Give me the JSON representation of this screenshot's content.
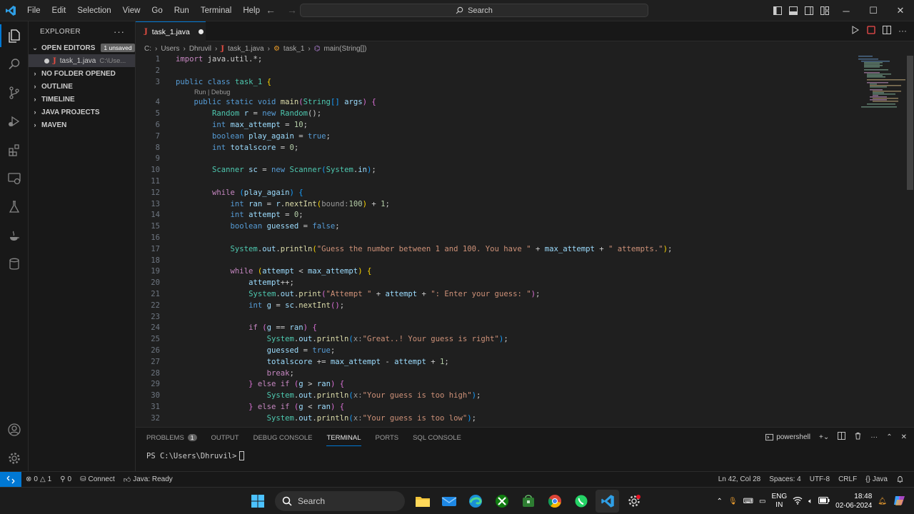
{
  "window": {
    "menu": [
      "File",
      "Edit",
      "Selection",
      "View",
      "Go",
      "Run",
      "Terminal",
      "Help"
    ],
    "search_label": "Search"
  },
  "sidebar": {
    "title": "EXPLORER",
    "open_editors": "OPEN EDITORS",
    "unsaved_badge": "1 unsaved",
    "open_file_name": "task_1.java",
    "open_file_path": "C:\\Use...",
    "sections": [
      "NO FOLDER OPENED",
      "OUTLINE",
      "TIMELINE",
      "JAVA PROJECTS",
      "MAVEN"
    ]
  },
  "editor": {
    "tab_label": "task_1.java",
    "breadcrumb": [
      "C:",
      "Users",
      "Dhruvil",
      "task_1.java",
      "task_1",
      "main(String[])"
    ],
    "codelens": "Run | Debug",
    "lines": [
      {
        "n": "1",
        "tokens": [
          [
            "import",
            "c"
          ],
          [
            " java.util.*;",
            ""
          ]
        ]
      },
      {
        "n": "2",
        "tokens": []
      },
      {
        "n": "3",
        "tokens": [
          [
            "public",
            "k"
          ],
          [
            " ",
            ""
          ],
          [
            "class",
            "k"
          ],
          [
            " ",
            ""
          ],
          [
            "task_1",
            "t"
          ],
          [
            " ",
            ""
          ],
          [
            "{",
            "p"
          ]
        ]
      },
      {
        "n": "4",
        "lens": true,
        "tokens": [
          [
            "    ",
            ""
          ],
          [
            "public",
            "k"
          ],
          [
            " ",
            ""
          ],
          [
            "static",
            "k"
          ],
          [
            " ",
            ""
          ],
          [
            "void",
            "k"
          ],
          [
            " ",
            ""
          ],
          [
            "main",
            "f"
          ],
          [
            "(",
            "pp"
          ],
          [
            "String",
            "t"
          ],
          [
            "[]",
            "pb"
          ],
          [
            " ",
            ""
          ],
          [
            "args",
            "v"
          ],
          [
            ")",
            "pp"
          ],
          [
            " ",
            ""
          ],
          [
            "{",
            "pp"
          ]
        ]
      },
      {
        "n": "5",
        "tokens": [
          [
            "        ",
            ""
          ],
          [
            "Random",
            "t"
          ],
          [
            " ",
            ""
          ],
          [
            "r",
            "v"
          ],
          [
            " = ",
            ""
          ],
          [
            "new",
            "k"
          ],
          [
            " ",
            ""
          ],
          [
            "Random",
            "t"
          ],
          [
            "();",
            ""
          ]
        ]
      },
      {
        "n": "6",
        "tokens": [
          [
            "        ",
            ""
          ],
          [
            "int",
            "k"
          ],
          [
            " ",
            ""
          ],
          [
            "max_attempt",
            "v"
          ],
          [
            " = ",
            ""
          ],
          [
            "10",
            "n"
          ],
          [
            ";",
            ""
          ]
        ]
      },
      {
        "n": "7",
        "tokens": [
          [
            "        ",
            ""
          ],
          [
            "boolean",
            "k"
          ],
          [
            " ",
            ""
          ],
          [
            "play_again",
            "v"
          ],
          [
            " = ",
            ""
          ],
          [
            "true",
            "k"
          ],
          [
            ";",
            ""
          ]
        ]
      },
      {
        "n": "8",
        "tokens": [
          [
            "        ",
            ""
          ],
          [
            "int",
            "k"
          ],
          [
            " ",
            ""
          ],
          [
            "totalscore",
            "v"
          ],
          [
            " = ",
            ""
          ],
          [
            "0",
            "n"
          ],
          [
            ";",
            ""
          ]
        ]
      },
      {
        "n": "9",
        "tokens": []
      },
      {
        "n": "10",
        "tokens": [
          [
            "        ",
            ""
          ],
          [
            "Scanner",
            "t"
          ],
          [
            " ",
            ""
          ],
          [
            "sc",
            "v"
          ],
          [
            " = ",
            ""
          ],
          [
            "new",
            "k"
          ],
          [
            " ",
            ""
          ],
          [
            "Scanner",
            "t"
          ],
          [
            "(",
            "pb"
          ],
          [
            "System",
            "t"
          ],
          [
            ".",
            ""
          ],
          [
            "in",
            "v"
          ],
          [
            ")",
            "pb"
          ],
          [
            ";",
            ""
          ]
        ]
      },
      {
        "n": "11",
        "tokens": []
      },
      {
        "n": "12",
        "tokens": [
          [
            "        ",
            ""
          ],
          [
            "while",
            "c"
          ],
          [
            " ",
            ""
          ],
          [
            "(",
            "pb"
          ],
          [
            "play_again",
            "v"
          ],
          [
            ")",
            "pb"
          ],
          [
            " ",
            ""
          ],
          [
            "{",
            "pb"
          ]
        ]
      },
      {
        "n": "13",
        "tokens": [
          [
            "            ",
            ""
          ],
          [
            "int",
            "k"
          ],
          [
            " ",
            ""
          ],
          [
            "ran",
            "v"
          ],
          [
            " = ",
            ""
          ],
          [
            "r",
            "v"
          ],
          [
            ".",
            ""
          ],
          [
            "nextInt",
            "f"
          ],
          [
            "(",
            "p"
          ],
          [
            "bound:",
            "h"
          ],
          [
            "100",
            "n"
          ],
          [
            ")",
            "p"
          ],
          [
            " + ",
            ""
          ],
          [
            "1",
            "n"
          ],
          [
            ";",
            ""
          ]
        ]
      },
      {
        "n": "14",
        "tokens": [
          [
            "            ",
            ""
          ],
          [
            "int",
            "k"
          ],
          [
            " ",
            ""
          ],
          [
            "attempt",
            "v"
          ],
          [
            " = ",
            ""
          ],
          [
            "0",
            "n"
          ],
          [
            ";",
            ""
          ]
        ]
      },
      {
        "n": "15",
        "tokens": [
          [
            "            ",
            ""
          ],
          [
            "boolean",
            "k"
          ],
          [
            " ",
            ""
          ],
          [
            "guessed",
            "v"
          ],
          [
            " = ",
            ""
          ],
          [
            "false",
            "k"
          ],
          [
            ";",
            ""
          ]
        ]
      },
      {
        "n": "16",
        "tokens": []
      },
      {
        "n": "17",
        "tokens": [
          [
            "            ",
            ""
          ],
          [
            "System",
            "t"
          ],
          [
            ".",
            ""
          ],
          [
            "out",
            "v"
          ],
          [
            ".",
            ""
          ],
          [
            "println",
            "f"
          ],
          [
            "(",
            "p"
          ],
          [
            "\"Guess the number between 1 and 100. You have \"",
            "s"
          ],
          [
            " + ",
            ""
          ],
          [
            "max_attempt",
            "v"
          ],
          [
            " + ",
            ""
          ],
          [
            "\" attempts.\"",
            "s"
          ],
          [
            ")",
            "p"
          ],
          [
            ";",
            ""
          ]
        ]
      },
      {
        "n": "18",
        "tokens": []
      },
      {
        "n": "19",
        "tokens": [
          [
            "            ",
            ""
          ],
          [
            "while",
            "c"
          ],
          [
            " ",
            ""
          ],
          [
            "(",
            "p"
          ],
          [
            "attempt",
            "v"
          ],
          [
            " < ",
            ""
          ],
          [
            "max_attempt",
            "v"
          ],
          [
            ")",
            "p"
          ],
          [
            " ",
            ""
          ],
          [
            "{",
            "p"
          ]
        ]
      },
      {
        "n": "20",
        "tokens": [
          [
            "                ",
            ""
          ],
          [
            "attempt",
            "v"
          ],
          [
            "++;",
            ""
          ]
        ]
      },
      {
        "n": "21",
        "tokens": [
          [
            "                ",
            ""
          ],
          [
            "System",
            "t"
          ],
          [
            ".",
            ""
          ],
          [
            "out",
            "v"
          ],
          [
            ".",
            ""
          ],
          [
            "print",
            "f"
          ],
          [
            "(",
            "pp"
          ],
          [
            "\"Attempt \"",
            "s"
          ],
          [
            " + ",
            ""
          ],
          [
            "attempt",
            "v"
          ],
          [
            " + ",
            ""
          ],
          [
            "\": Enter your guess: \"",
            "s"
          ],
          [
            ")",
            "pp"
          ],
          [
            ";",
            ""
          ]
        ]
      },
      {
        "n": "22",
        "tokens": [
          [
            "                ",
            ""
          ],
          [
            "int",
            "k"
          ],
          [
            " ",
            ""
          ],
          [
            "g",
            "v"
          ],
          [
            " = ",
            ""
          ],
          [
            "sc",
            "v"
          ],
          [
            ".",
            ""
          ],
          [
            "nextInt",
            "f"
          ],
          [
            "()",
            "pp"
          ],
          [
            ";",
            ""
          ]
        ]
      },
      {
        "n": "23",
        "tokens": []
      },
      {
        "n": "24",
        "tokens": [
          [
            "                ",
            ""
          ],
          [
            "if",
            "c"
          ],
          [
            " ",
            ""
          ],
          [
            "(",
            "pp"
          ],
          [
            "g",
            "v"
          ],
          [
            " == ",
            ""
          ],
          [
            "ran",
            "v"
          ],
          [
            ")",
            "pp"
          ],
          [
            " ",
            ""
          ],
          [
            "{",
            "pp"
          ]
        ]
      },
      {
        "n": "25",
        "tokens": [
          [
            "                    ",
            ""
          ],
          [
            "System",
            "t"
          ],
          [
            ".",
            ""
          ],
          [
            "out",
            "v"
          ],
          [
            ".",
            ""
          ],
          [
            "println",
            "f"
          ],
          [
            "(",
            "pb"
          ],
          [
            "x:",
            "h"
          ],
          [
            "\"Great..! Your guess is right\"",
            "s"
          ],
          [
            ")",
            "pb"
          ],
          [
            ";",
            ""
          ]
        ]
      },
      {
        "n": "26",
        "tokens": [
          [
            "                    ",
            ""
          ],
          [
            "guessed",
            "v"
          ],
          [
            " = ",
            ""
          ],
          [
            "true",
            "k"
          ],
          [
            ";",
            ""
          ]
        ]
      },
      {
        "n": "27",
        "tokens": [
          [
            "                    ",
            ""
          ],
          [
            "totalscore",
            "v"
          ],
          [
            " += ",
            ""
          ],
          [
            "max_attempt",
            "v"
          ],
          [
            " - ",
            ""
          ],
          [
            "attempt",
            "v"
          ],
          [
            " + ",
            ""
          ],
          [
            "1",
            "n"
          ],
          [
            ";",
            ""
          ]
        ]
      },
      {
        "n": "28",
        "tokens": [
          [
            "                    ",
            ""
          ],
          [
            "break",
            "c"
          ],
          [
            ";",
            ""
          ]
        ]
      },
      {
        "n": "29",
        "tokens": [
          [
            "                ",
            ""
          ],
          [
            "}",
            "pp"
          ],
          [
            " ",
            ""
          ],
          [
            "else",
            "c"
          ],
          [
            " ",
            ""
          ],
          [
            "if",
            "c"
          ],
          [
            " ",
            ""
          ],
          [
            "(",
            "pp"
          ],
          [
            "g",
            "v"
          ],
          [
            " > ",
            ""
          ],
          [
            "ran",
            "v"
          ],
          [
            ")",
            "pp"
          ],
          [
            " ",
            ""
          ],
          [
            "{",
            "pp"
          ]
        ]
      },
      {
        "n": "30",
        "tokens": [
          [
            "                    ",
            ""
          ],
          [
            "System",
            "t"
          ],
          [
            ".",
            ""
          ],
          [
            "out",
            "v"
          ],
          [
            ".",
            ""
          ],
          [
            "println",
            "f"
          ],
          [
            "(",
            "pb"
          ],
          [
            "x:",
            "h"
          ],
          [
            "\"Your guess is too high\"",
            "s"
          ],
          [
            ")",
            "pb"
          ],
          [
            ";",
            ""
          ]
        ]
      },
      {
        "n": "31",
        "tokens": [
          [
            "                ",
            ""
          ],
          [
            "}",
            "pp"
          ],
          [
            " ",
            ""
          ],
          [
            "else",
            "c"
          ],
          [
            " ",
            ""
          ],
          [
            "if",
            "c"
          ],
          [
            " ",
            ""
          ],
          [
            "(",
            "pp"
          ],
          [
            "g",
            "v"
          ],
          [
            " < ",
            ""
          ],
          [
            "ran",
            "v"
          ],
          [
            ")",
            "pp"
          ],
          [
            " ",
            ""
          ],
          [
            "{",
            "pp"
          ]
        ]
      },
      {
        "n": "32",
        "tokens": [
          [
            "                    ",
            ""
          ],
          [
            "System",
            "t"
          ],
          [
            ".",
            ""
          ],
          [
            "out",
            "v"
          ],
          [
            ".",
            ""
          ],
          [
            "println",
            "f"
          ],
          [
            "(",
            "pb"
          ],
          [
            "x:",
            "h"
          ],
          [
            "\"Your guess is too low\"",
            "s"
          ],
          [
            ")",
            "pb"
          ],
          [
            ";",
            ""
          ]
        ]
      }
    ]
  },
  "panel": {
    "tabs": [
      "PROBLEMS",
      "OUTPUT",
      "DEBUG CONSOLE",
      "TERMINAL",
      "PORTS",
      "SQL CONSOLE"
    ],
    "problems_count": "1",
    "active_tab": "TERMINAL",
    "shell_label": "powershell",
    "prompt": "PS C:\\Users\\Dhruvil>"
  },
  "statusbar": {
    "errors": "0",
    "warnings": "1",
    "ports": "0",
    "connect": "Connect",
    "java_status": "Java: Ready",
    "position": "Ln 42, Col 28",
    "spaces": "Spaces: 4",
    "encoding": "UTF-8",
    "eol": "CRLF",
    "language": "Java"
  },
  "taskbar": {
    "search": "Search",
    "lang_top": "ENG",
    "lang_bottom": "IN",
    "time": "18:48",
    "date": "02-06-2024"
  }
}
